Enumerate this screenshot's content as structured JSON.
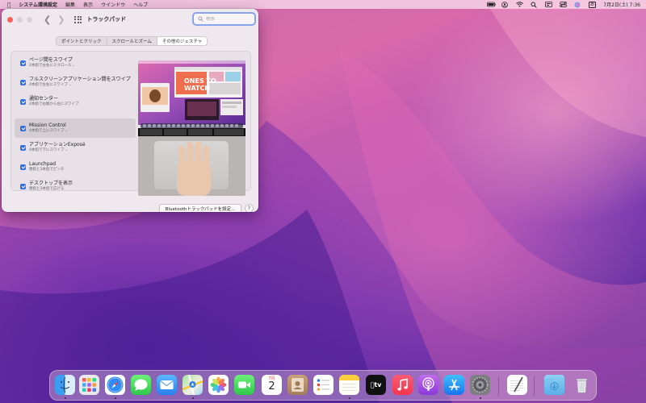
{
  "menubar": {
    "app_name": "システム環境設定",
    "items": [
      "編集",
      "表示",
      "ウインドウ",
      "ヘルプ"
    ],
    "ime": "あ",
    "datetime": "7月2日(土) 7:36"
  },
  "window": {
    "title": "トラックパッド",
    "search_placeholder": "検索",
    "tabs": [
      "ポイントとクリック",
      "スクロールとズーム",
      "その他のジェスチャ"
    ],
    "active_tab": 2,
    "options": [
      {
        "title": "ページ間をスワイプ",
        "subtitle": "2本指で左右にスクロール",
        "checked": true,
        "has_menu": true
      },
      {
        "title": "フルスクリーンアプリケーション間をスワイプ",
        "subtitle": "4本指で左右にスワイプ",
        "checked": true,
        "has_menu": true
      },
      {
        "title": "通知センター",
        "subtitle": "2本指で右端から左にスワイプ",
        "checked": true,
        "has_menu": false
      },
      {
        "title": "Mission Control",
        "subtitle": "4本指で上にスワイプ",
        "checked": true,
        "has_menu": true
      },
      {
        "title": "アプリケーションExposé",
        "subtitle": "4本指で下にスワイプ",
        "checked": true,
        "has_menu": true
      },
      {
        "title": "Launchpad",
        "subtitle": "親指と3本指でピンチ",
        "checked": true,
        "has_menu": false
      },
      {
        "title": "デスクトップを表示",
        "subtitle": "親指と3本指で広げる",
        "checked": true,
        "has_menu": false
      }
    ],
    "selected_option": 3,
    "preview_text": [
      "ONES TO",
      "WATCH"
    ],
    "bluetooth_button": "Bluetoothトラックパッドを設定...",
    "help_button": "?"
  },
  "dock": {
    "calendar_month": "7月",
    "calendar_day": "2",
    "tv_label": "tv",
    "apps": [
      "finder",
      "launchpad",
      "safari",
      "messages",
      "mail",
      "maps",
      "photos",
      "facetime",
      "calendar",
      "contacts",
      "reminders",
      "notes",
      "tv",
      "music",
      "podcasts",
      "app-store",
      "system-preferences",
      "textedit",
      "downloads",
      "trash"
    ]
  },
  "colors": {
    "accent": "#2f6fe3",
    "close": "#fe5f57",
    "search_focus": "#86a6ec"
  }
}
